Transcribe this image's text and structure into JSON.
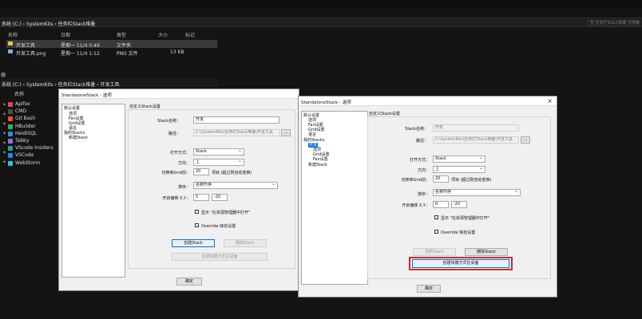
{
  "explorer": {
    "window_title": "文件资源管理器",
    "address_top": "系统 (C:)  ›  SystemKits  ›  任务栏Stack堆叠",
    "search_placeholder": "在 任务栏Stack堆叠 中搜索",
    "columns": [
      "名称",
      "日期",
      "类型",
      "大小",
      "标记"
    ],
    "files": [
      {
        "name": "开发工具",
        "date": "星期一 11/4 0:49",
        "type": "文件夹",
        "size": "",
        "kind": "folder"
      },
      {
        "name": "开发工具.png",
        "date": "星期一 11/4 1:12",
        "type": "PNG 文件",
        "size": "13 KB",
        "kind": "png"
      }
    ],
    "left_label": "器",
    "address_sub": "系统 (C:)  ›  SystemKits  ›  任务栏Stack堆叠  ›  开发工具",
    "sub_column": "名称",
    "stack_items": [
      {
        "label": "Apifox",
        "color": "#e8425a"
      },
      {
        "label": "CMD",
        "color": "#4d4d4d"
      },
      {
        "label": "Git Bash",
        "color": "#f0502f"
      },
      {
        "label": "HBuilder",
        "color": "#2fb34a"
      },
      {
        "label": "HeidiSQL",
        "color": "#3a8fd8"
      },
      {
        "label": "Tabby",
        "color": "#9c6ad6"
      },
      {
        "label": "VScode Insiders",
        "color": "#2a9d8f"
      },
      {
        "label": "VSCode",
        "color": "#1e88e5"
      },
      {
        "label": "WebStorm",
        "color": "#27c6e0"
      }
    ]
  },
  "dialog1": {
    "title": "StandaloneStack - 选项",
    "tree": [
      "默认设置",
      "选项",
      "Fan设置",
      "Grid设置",
      "语言",
      "我的Stacks",
      "新建Stack"
    ],
    "group_title": "自定义Stack设置",
    "stack_name_label": "Stack名称：",
    "stack_name_value": "开发",
    "path_label": "路径：",
    "path_value": "C:\\SystemKits\\任务栏Stack堆叠\\开发工具",
    "browse_label": "...",
    "open_mode_label": "打开方式：",
    "open_mode_value": "Stack",
    "direction_label": "方向：",
    "direction_value": "上",
    "switch_grid_label": "切换到Grid前：",
    "switch_grid_value": "20",
    "switch_grid_hint": "项目 (超过则自动变换)",
    "sort_label": "排序：",
    "sort_value": "名称升序",
    "offset_label": "开启偏移 X,Y：",
    "offset_x": "0",
    "offset_y": "-20",
    "show_explorer_label": "显示 \"在资源管理器中打开\"",
    "override_label": "Override 缺省设置",
    "create_stack_label": "创建Stack",
    "delete_stack_label": "删除Stack",
    "create_shortcut_label": "创建快捷方式在桌面",
    "ok_label": "确定"
  },
  "dialog2": {
    "title": "StandaloneStack - 选项",
    "tree": [
      "默认设置",
      "选项",
      "Fan设置",
      "Grid设置",
      "语言",
      "我的Stacks",
      "开发",
      "选项",
      "Grid设置",
      "Fan设置",
      "新建Stack"
    ],
    "selected_tree_index": 6,
    "group_title": "自定义Stack设置",
    "stack_name_label": "Stack名称：",
    "stack_name_value": "开发",
    "path_label": "路径：",
    "path_value": "C:\\SystemKits\\任务栏Stack堆叠\\开发工具",
    "browse_label": "...",
    "open_mode_label": "打开方式：",
    "open_mode_value": "Stack",
    "direction_label": "方向：",
    "direction_value": "上",
    "switch_grid_label": "切换到Grid前：",
    "switch_grid_value": "20",
    "switch_grid_hint": "项目 (超过则自动变换)",
    "sort_label": "排序：",
    "sort_value": "名称升序",
    "offset_label": "开启偏移 X,Y：",
    "offset_x": "0",
    "offset_y": "-20",
    "show_explorer_label": "显示 \"在资源管理器中打开\"",
    "override_label": "Override 缺省设置",
    "update_stack_label": "更新Stack",
    "delete_stack_label": "删除Stack",
    "create_shortcut_label": "创建快捷方式在桌面",
    "ok_label": "确定"
  }
}
